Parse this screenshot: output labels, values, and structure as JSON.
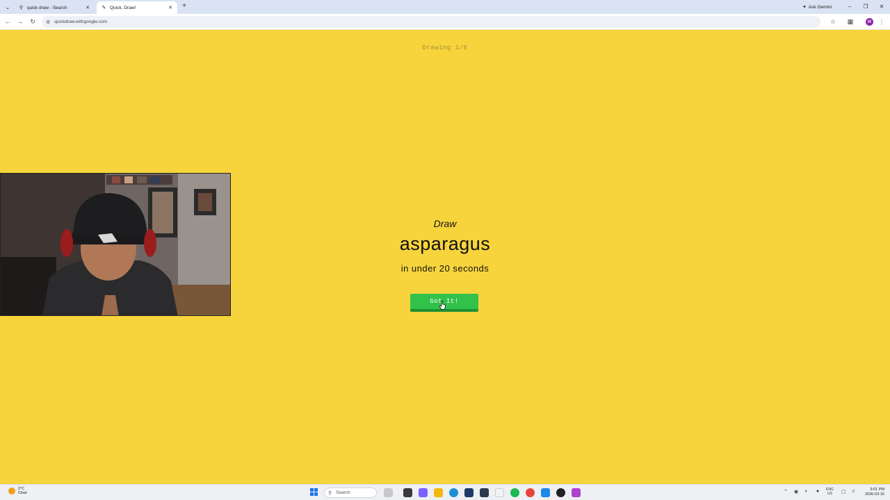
{
  "browser": {
    "tabs": [
      {
        "title": "quick draw - Search",
        "favicon": "search-icon"
      },
      {
        "title": "Quick, Draw!",
        "favicon": "quickdraw-icon",
        "active": true
      }
    ],
    "gemini_label": "Ask Gemini",
    "url": "quickdraw.withgoogle.com",
    "profile_initial": "H"
  },
  "page": {
    "counter": "Drawing 1/6",
    "draw_word": "Draw",
    "subject": "asparagus",
    "time_text": "in under 20 seconds",
    "button_label": "Got It!",
    "background_color": "#f7d43c",
    "button_color": "#32c24a"
  },
  "taskbar": {
    "weather_temp": "2°C",
    "weather_desc": "Clear",
    "search_placeholder": "Search",
    "lang_line1": "ENG",
    "lang_line2": "US",
    "time": "9:01 PM",
    "date": "2026-03-15"
  }
}
